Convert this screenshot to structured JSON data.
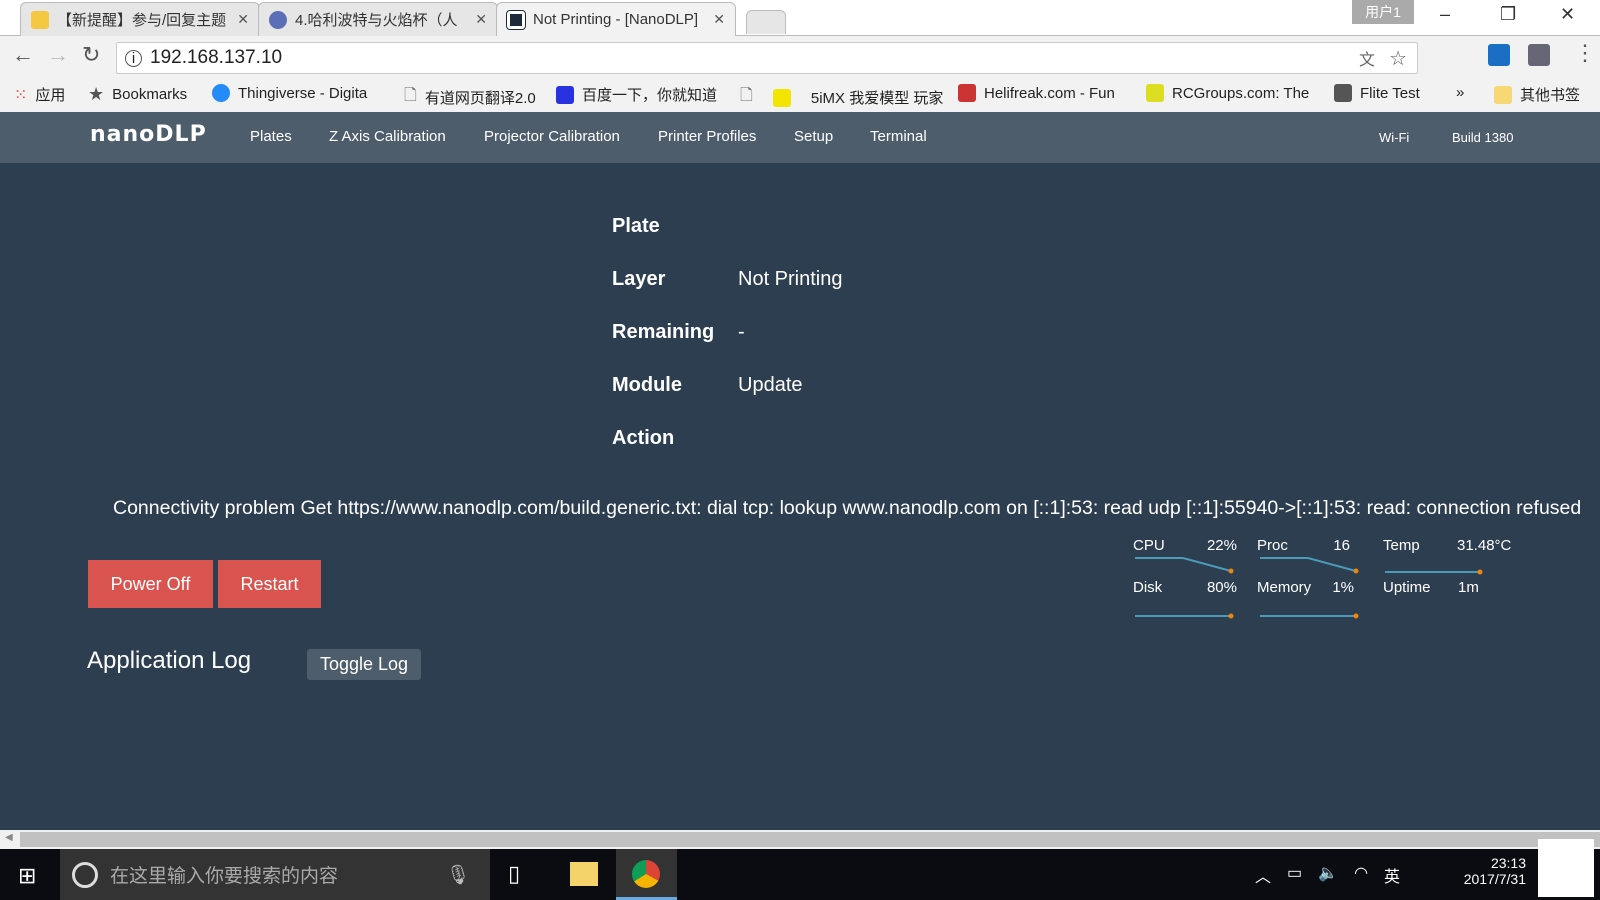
{
  "browser": {
    "profile": "用户1",
    "tabs": [
      {
        "title": "【新提醒】参与/回复主题",
        "icon": "bulb-icon",
        "color": "#f5c842"
      },
      {
        "title": "4.哈利波特与火焰杯（人",
        "icon": "avatar-icon",
        "color": "#5a6fb5"
      },
      {
        "title": "Not Printing - [NanoDLP]",
        "icon": "nanodlp-icon",
        "color": "#1d2a38"
      }
    ],
    "url": "192.168.137.10",
    "bookmarks": [
      {
        "label": "应用",
        "icon": "apps-icon"
      },
      {
        "label": "Bookmarks",
        "icon": "star-icon"
      },
      {
        "label": "Thingiverse - Digita",
        "icon": "thingiverse-icon"
      },
      {
        "label": "有道网页翻译2.0",
        "icon": "page-icon"
      },
      {
        "label": "百度一下，你就知道",
        "icon": "baidu-icon"
      },
      {
        "label": "5iMX 我爱模型 玩家",
        "icon": "5imx-icon"
      },
      {
        "label": "Helifreak.com - Fun",
        "icon": "helifreak-icon"
      },
      {
        "label": "RCGroups.com: The",
        "icon": "rcgroups-icon"
      },
      {
        "label": "Flite Test",
        "icon": "flitetest-icon"
      }
    ],
    "more": "»",
    "other_bookmarks": "其他书签"
  },
  "nav": {
    "logo": "nanoDLP",
    "items": [
      "Plates",
      "Z Axis Calibration",
      "Projector Calibration",
      "Printer Profiles",
      "Setup",
      "Terminal"
    ],
    "right": [
      "Wi-Fi",
      "Build 1380"
    ]
  },
  "status": {
    "rows": [
      {
        "label": "Plate",
        "value": ""
      },
      {
        "label": "Layer",
        "value": "Not Printing"
      },
      {
        "label": "Remaining",
        "value": "-"
      },
      {
        "label": "Module",
        "value": "Update"
      },
      {
        "label": "Action",
        "value": ""
      }
    ]
  },
  "message": "Connectivity problem Get https://www.nanodlp.com/build.generic.txt: dial tcp: lookup www.nanodlp.com on [::1]:53: read udp [::1]:55940->[::1]:53: read: connection refused",
  "buttons": {
    "power_off": "Power Off",
    "restart": "Restart",
    "toggle_log": "Toggle Log"
  },
  "log_title": "Application Log",
  "stats": [
    {
      "label": "CPU",
      "value": "22%"
    },
    {
      "label": "Proc",
      "value": "16"
    },
    {
      "label": "Temp",
      "value": "31.48°C"
    },
    {
      "label": "Disk",
      "value": "80%"
    },
    {
      "label": "Memory",
      "value": "1%"
    },
    {
      "label": "Uptime",
      "value": "1m"
    }
  ],
  "taskbar": {
    "search_placeholder": "在这里输入你要搜索的内容",
    "ime": "英",
    "time": "23:13",
    "date": "2017/7/31"
  },
  "colors": {
    "bg": "#2c3e50",
    "nav": "#4e5d6c",
    "danger": "#d9534f",
    "spark": "#4a9ab8",
    "spark_dot": "#f0850a"
  }
}
